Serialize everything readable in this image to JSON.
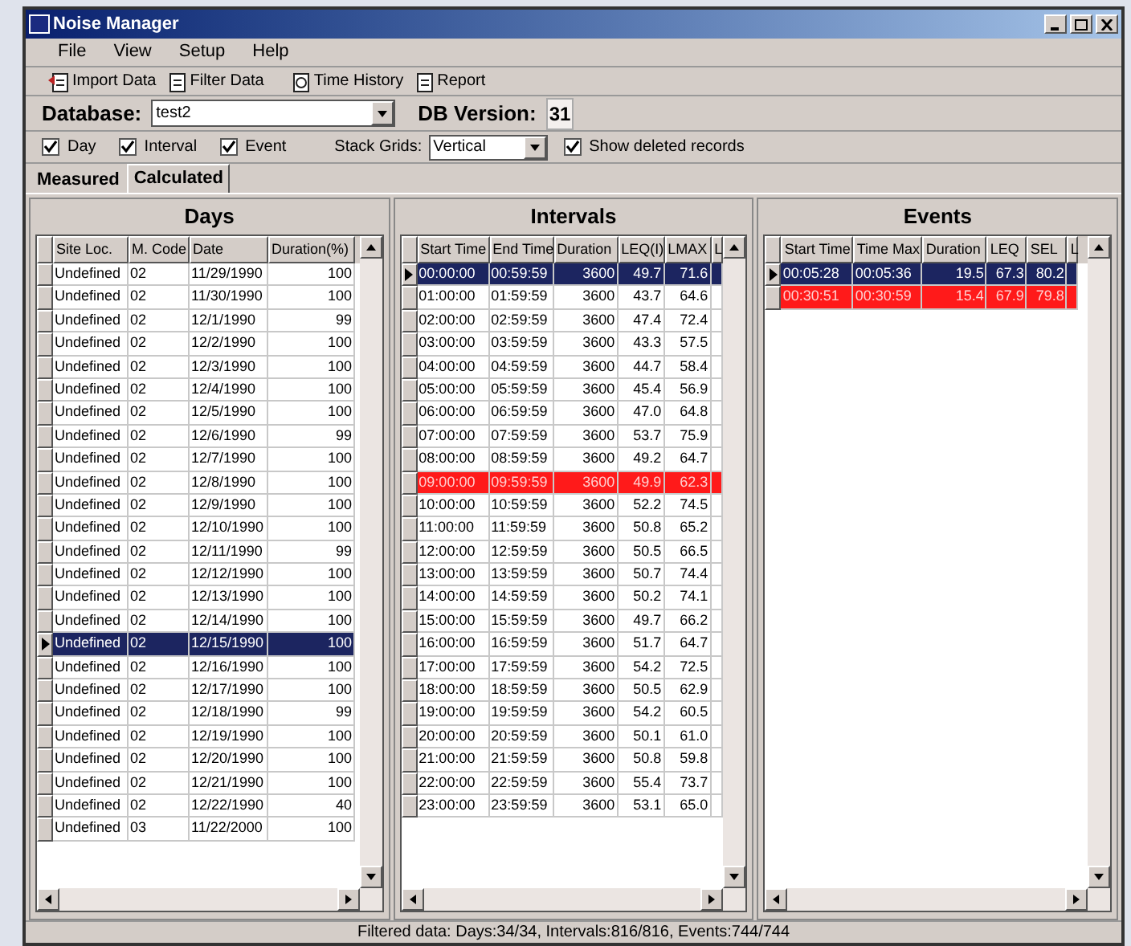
{
  "window": {
    "title": "Noise Manager"
  },
  "menu": [
    "File",
    "View",
    "Setup",
    "Help"
  ],
  "toolbar": [
    "Import Data",
    "Filter Data",
    "Time History",
    "Report"
  ],
  "database": {
    "label": "Database:",
    "value": "test2",
    "version_label": "DB Version:",
    "version": "31"
  },
  "options": [
    {
      "label": "Day",
      "checked": true
    },
    {
      "label": "Interval",
      "checked": true
    },
    {
      "label": "Event",
      "checked": true
    }
  ],
  "stack_grids": {
    "label": "Stack Grids:",
    "value": "Vertical"
  },
  "show_deleted": {
    "label": "Show deleted records",
    "checked": true
  },
  "tabs": [
    {
      "label": "Measured",
      "selected": false
    },
    {
      "label": "Calculated",
      "selected": true
    }
  ],
  "grids": [
    {
      "title": "Days",
      "columns": [
        {
          "label": "Site Loc.",
          "numeric": false
        },
        {
          "label": "M. Code",
          "numeric": false
        },
        {
          "label": "Date",
          "numeric": false
        },
        {
          "label": "Duration(%)",
          "numeric": true
        }
      ],
      "rows": [
        {
          "cells": [
            "Undefined",
            "02",
            "11/29/1990",
            "100"
          ],
          "selected": false,
          "flagged": false
        },
        {
          "cells": [
            "Undefined",
            "02",
            "11/30/1990",
            "100"
          ],
          "selected": false,
          "flagged": false
        },
        {
          "cells": [
            "Undefined",
            "02",
            "12/1/1990",
            "99"
          ],
          "selected": false,
          "flagged": false
        },
        {
          "cells": [
            "Undefined",
            "02",
            "12/2/1990",
            "100"
          ],
          "selected": false,
          "flagged": false
        },
        {
          "cells": [
            "Undefined",
            "02",
            "12/3/1990",
            "100"
          ],
          "selected": false,
          "flagged": false
        },
        {
          "cells": [
            "Undefined",
            "02",
            "12/4/1990",
            "100"
          ],
          "selected": false,
          "flagged": false
        },
        {
          "cells": [
            "Undefined",
            "02",
            "12/5/1990",
            "100"
          ],
          "selected": false,
          "flagged": false
        },
        {
          "cells": [
            "Undefined",
            "02",
            "12/6/1990",
            "99"
          ],
          "selected": false,
          "flagged": false
        },
        {
          "cells": [
            "Undefined",
            "02",
            "12/7/1990",
            "100"
          ],
          "selected": false,
          "flagged": false
        },
        {
          "cells": [
            "Undefined",
            "02",
            "12/8/1990",
            "100"
          ],
          "selected": false,
          "flagged": false
        },
        {
          "cells": [
            "Undefined",
            "02",
            "12/9/1990",
            "100"
          ],
          "selected": false,
          "flagged": false
        },
        {
          "cells": [
            "Undefined",
            "02",
            "12/10/1990",
            "100"
          ],
          "selected": false,
          "flagged": false
        },
        {
          "cells": [
            "Undefined",
            "02",
            "12/11/1990",
            "99"
          ],
          "selected": false,
          "flagged": false
        },
        {
          "cells": [
            "Undefined",
            "02",
            "12/12/1990",
            "100"
          ],
          "selected": false,
          "flagged": false
        },
        {
          "cells": [
            "Undefined",
            "02",
            "12/13/1990",
            "100"
          ],
          "selected": false,
          "flagged": false
        },
        {
          "cells": [
            "Undefined",
            "02",
            "12/14/1990",
            "100"
          ],
          "selected": false,
          "flagged": false
        },
        {
          "cells": [
            "Undefined",
            "02",
            "12/15/1990",
            "100"
          ],
          "selected": true,
          "flagged": false
        },
        {
          "cells": [
            "Undefined",
            "02",
            "12/16/1990",
            "100"
          ],
          "selected": false,
          "flagged": false
        },
        {
          "cells": [
            "Undefined",
            "02",
            "12/17/1990",
            "100"
          ],
          "selected": false,
          "flagged": false
        },
        {
          "cells": [
            "Undefined",
            "02",
            "12/18/1990",
            "99"
          ],
          "selected": false,
          "flagged": false
        },
        {
          "cells": [
            "Undefined",
            "02",
            "12/19/1990",
            "100"
          ],
          "selected": false,
          "flagged": false
        },
        {
          "cells": [
            "Undefined",
            "02",
            "12/20/1990",
            "100"
          ],
          "selected": false,
          "flagged": false
        },
        {
          "cells": [
            "Undefined",
            "02",
            "12/21/1990",
            "100"
          ],
          "selected": false,
          "flagged": false
        },
        {
          "cells": [
            "Undefined",
            "02",
            "12/22/1990",
            "40"
          ],
          "selected": false,
          "flagged": false
        },
        {
          "cells": [
            "Undefined",
            "03",
            "11/22/2000",
            "100"
          ],
          "selected": false,
          "flagged": false
        }
      ]
    },
    {
      "title": "Intervals",
      "columns": [
        {
          "label": "Start Time",
          "numeric": false
        },
        {
          "label": "End Time",
          "numeric": false
        },
        {
          "label": "Duration",
          "numeric": true
        },
        {
          "label": "LEQ(I)",
          "numeric": true
        },
        {
          "label": "LMAX",
          "numeric": true
        },
        {
          "label": "L",
          "numeric": false
        }
      ],
      "rows": [
        {
          "cells": [
            "00:00:00",
            "00:59:59",
            "3600",
            "49.7",
            "71.6"
          ],
          "selected": true,
          "flagged": false
        },
        {
          "cells": [
            "01:00:00",
            "01:59:59",
            "3600",
            "43.7",
            "64.6"
          ],
          "selected": false,
          "flagged": false
        },
        {
          "cells": [
            "02:00:00",
            "02:59:59",
            "3600",
            "47.4",
            "72.4"
          ],
          "selected": false,
          "flagged": false
        },
        {
          "cells": [
            "03:00:00",
            "03:59:59",
            "3600",
            "43.3",
            "57.5"
          ],
          "selected": false,
          "flagged": false
        },
        {
          "cells": [
            "04:00:00",
            "04:59:59",
            "3600",
            "44.7",
            "58.4"
          ],
          "selected": false,
          "flagged": false
        },
        {
          "cells": [
            "05:00:00",
            "05:59:59",
            "3600",
            "45.4",
            "56.9"
          ],
          "selected": false,
          "flagged": false
        },
        {
          "cells": [
            "06:00:00",
            "06:59:59",
            "3600",
            "47.0",
            "64.8"
          ],
          "selected": false,
          "flagged": false
        },
        {
          "cells": [
            "07:00:00",
            "07:59:59",
            "3600",
            "53.7",
            "75.9"
          ],
          "selected": false,
          "flagged": false
        },
        {
          "cells": [
            "08:00:00",
            "08:59:59",
            "3600",
            "49.2",
            "64.7"
          ],
          "selected": false,
          "flagged": false
        },
        {
          "cells": [
            "09:00:00",
            "09:59:59",
            "3600",
            "49.9",
            "62.3"
          ],
          "selected": false,
          "flagged": true
        },
        {
          "cells": [
            "10:00:00",
            "10:59:59",
            "3600",
            "52.2",
            "74.5"
          ],
          "selected": false,
          "flagged": false
        },
        {
          "cells": [
            "11:00:00",
            "11:59:59",
            "3600",
            "50.8",
            "65.2"
          ],
          "selected": false,
          "flagged": false
        },
        {
          "cells": [
            "12:00:00",
            "12:59:59",
            "3600",
            "50.5",
            "66.5"
          ],
          "selected": false,
          "flagged": false
        },
        {
          "cells": [
            "13:00:00",
            "13:59:59",
            "3600",
            "50.7",
            "74.4"
          ],
          "selected": false,
          "flagged": false
        },
        {
          "cells": [
            "14:00:00",
            "14:59:59",
            "3600",
            "50.2",
            "74.1"
          ],
          "selected": false,
          "flagged": false
        },
        {
          "cells": [
            "15:00:00",
            "15:59:59",
            "3600",
            "49.7",
            "66.2"
          ],
          "selected": false,
          "flagged": false
        },
        {
          "cells": [
            "16:00:00",
            "16:59:59",
            "3600",
            "51.7",
            "64.7"
          ],
          "selected": false,
          "flagged": false
        },
        {
          "cells": [
            "17:00:00",
            "17:59:59",
            "3600",
            "54.2",
            "72.5"
          ],
          "selected": false,
          "flagged": false
        },
        {
          "cells": [
            "18:00:00",
            "18:59:59",
            "3600",
            "50.5",
            "62.9"
          ],
          "selected": false,
          "flagged": false
        },
        {
          "cells": [
            "19:00:00",
            "19:59:59",
            "3600",
            "54.2",
            "60.5"
          ],
          "selected": false,
          "flagged": false
        },
        {
          "cells": [
            "20:00:00",
            "20:59:59",
            "3600",
            "50.1",
            "61.0"
          ],
          "selected": false,
          "flagged": false
        },
        {
          "cells": [
            "21:00:00",
            "21:59:59",
            "3600",
            "50.8",
            "59.8"
          ],
          "selected": false,
          "flagged": false
        },
        {
          "cells": [
            "22:00:00",
            "22:59:59",
            "3600",
            "55.4",
            "73.7"
          ],
          "selected": false,
          "flagged": false
        },
        {
          "cells": [
            "23:00:00",
            "23:59:59",
            "3600",
            "53.1",
            "65.0"
          ],
          "selected": false,
          "flagged": false
        }
      ]
    },
    {
      "title": "Events",
      "columns": [
        {
          "label": "Start Time",
          "numeric": false
        },
        {
          "label": "Time Max",
          "numeric": false
        },
        {
          "label": "Duration",
          "numeric": true
        },
        {
          "label": "LEQ",
          "numeric": true
        },
        {
          "label": "SEL",
          "numeric": true
        },
        {
          "label": "L",
          "numeric": false
        }
      ],
      "rows": [
        {
          "cells": [
            "00:05:28",
            "00:05:36",
            "19.5",
            "67.3",
            "80.2"
          ],
          "selected": true,
          "flagged": false
        },
        {
          "cells": [
            "00:30:51",
            "00:30:59",
            "15.4",
            "67.9",
            "79.8"
          ],
          "selected": false,
          "flagged": true
        }
      ]
    }
  ],
  "status_bar": "Filtered data: Days:34/34, Intervals:816/816, Events:744/744"
}
